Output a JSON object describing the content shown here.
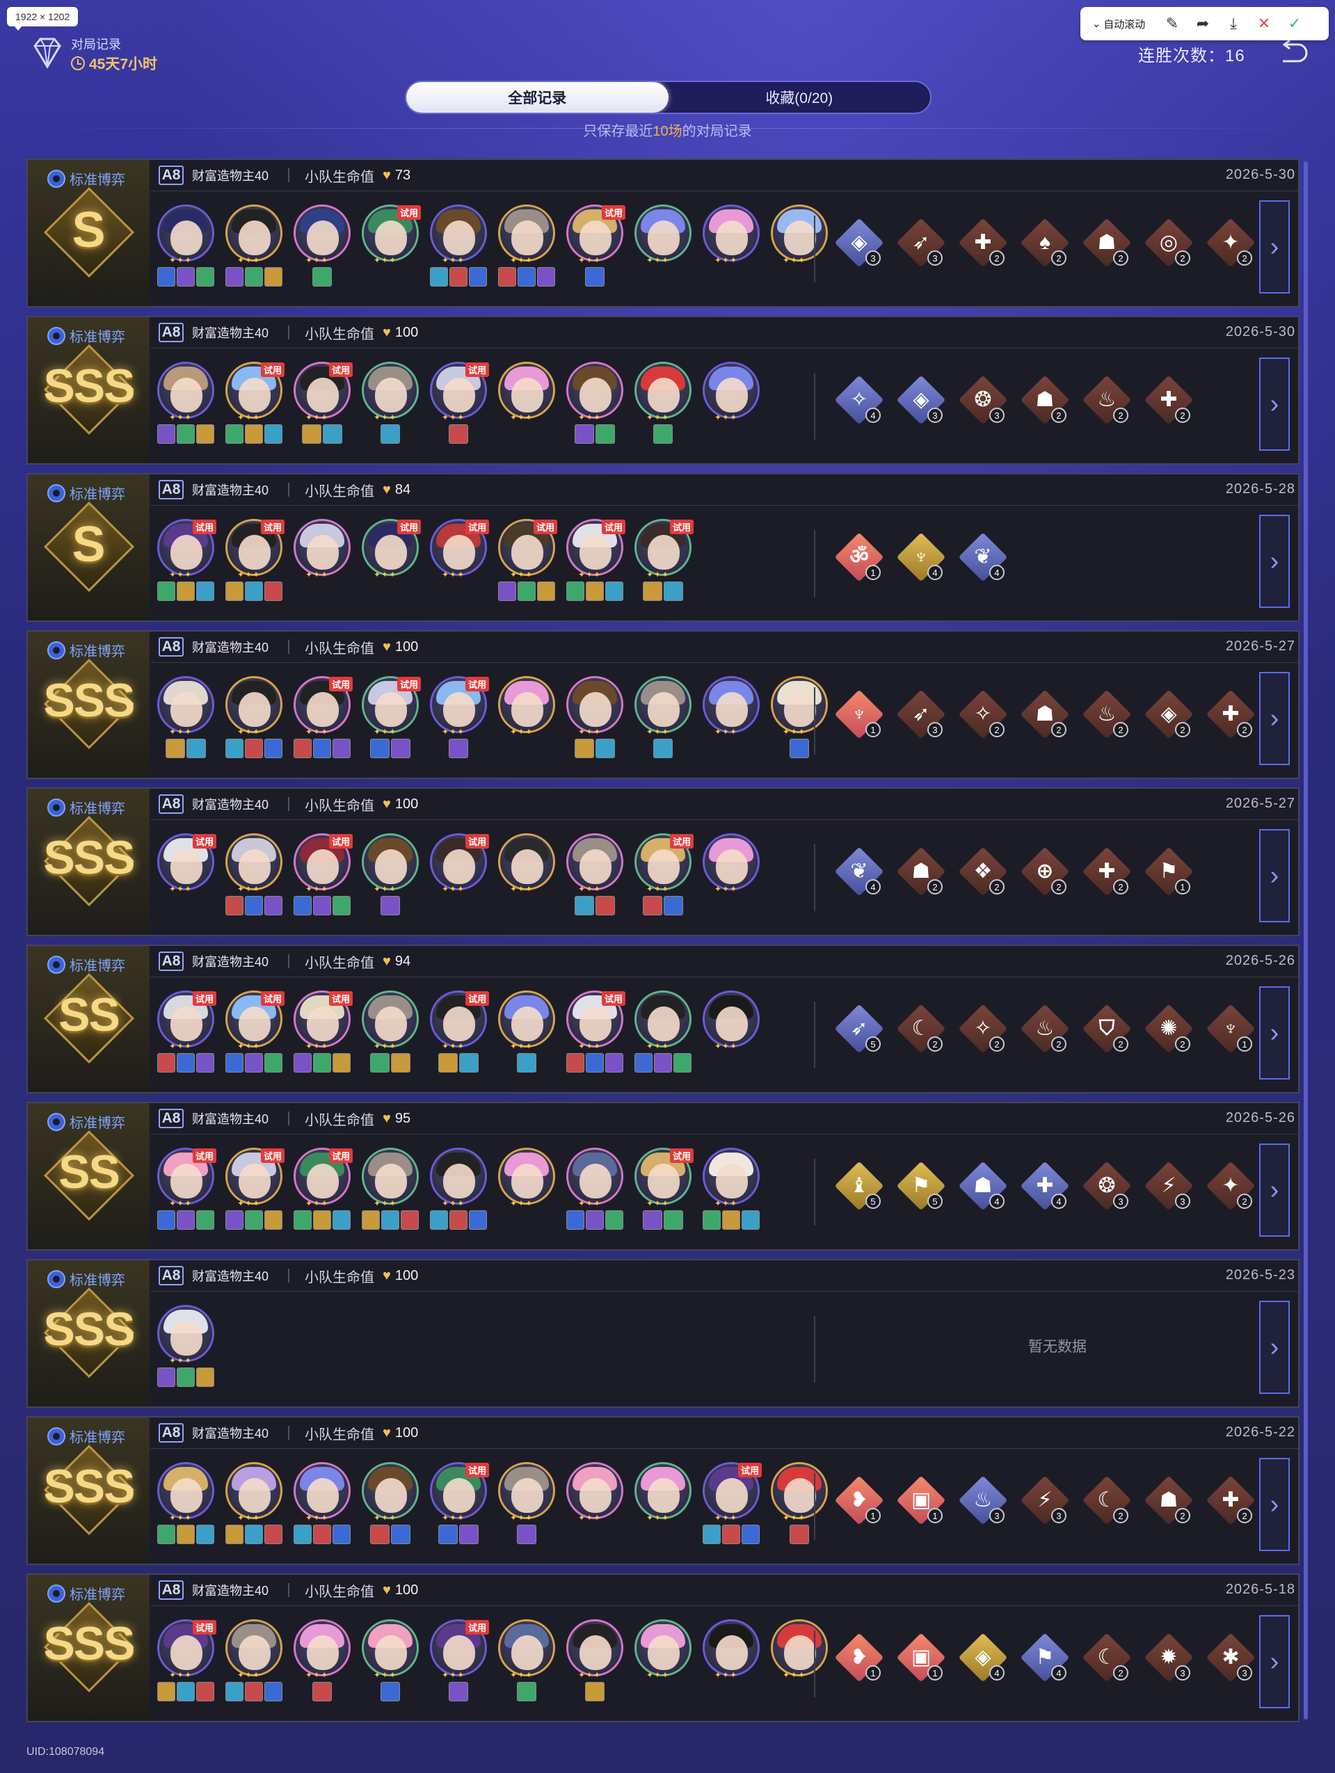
{
  "size_badge": "1922 × 1202",
  "header": {
    "title": "对局记录",
    "time": "45天7小时",
    "streak": "连胜次数：16"
  },
  "toolbar": {
    "auto_scroll": "自动滚动"
  },
  "tabs": [
    {
      "label": "全部记录"
    },
    {
      "label": "收藏(0/20)"
    }
  ],
  "hint": {
    "prefix": "只保存最近",
    "num": "10场",
    "suffix": "的对局记录"
  },
  "common": {
    "mode": "标准博弈",
    "level": "A8",
    "difficulty": "财富造物主40",
    "hp_label": "小队生命值",
    "nodata": "暂无数据"
  },
  "records": [
    {
      "grade": "S",
      "hp": "73",
      "date": "2026-5-30",
      "chars": [
        {
          "t": 0,
          "c": "#2a2a66",
          "r": 3
        },
        {
          "t": 0,
          "c": "#222",
          "r": 3
        },
        {
          "t": 0,
          "c": "#2f3f88",
          "r": 1
        },
        {
          "t": 1,
          "c": "#3b8a5e",
          "r": 0
        },
        {
          "t": 0,
          "c": "#6a4a2a",
          "r": 3
        },
        {
          "t": 0,
          "c": "#9a8f88",
          "r": 3
        },
        {
          "t": 1,
          "c": "#d4b06a",
          "r": 1
        },
        {
          "t": 0,
          "c": "#7a86e8",
          "r": 0
        },
        {
          "t": 0,
          "c": "#e89ad6",
          "r": 0
        },
        {
          "t": 0,
          "c": "#9ab8f0",
          "r": 0
        }
      ],
      "paths": [
        {
          "k": "b",
          "g": "◈",
          "n": "3"
        },
        {
          "k": "r",
          "g": "➶",
          "n": "3"
        },
        {
          "k": "r",
          "g": "✚",
          "n": "2"
        },
        {
          "k": "r",
          "g": "♠",
          "n": "2"
        },
        {
          "k": "r",
          "g": "☗",
          "n": "2"
        },
        {
          "k": "r",
          "g": "◎",
          "n": "2"
        },
        {
          "k": "r",
          "g": "✦",
          "n": "2"
        }
      ]
    },
    {
      "grade": "SSS",
      "hp": "100",
      "date": "2026-5-30",
      "chars": [
        {
          "t": 0,
          "c": "#b89a7a",
          "r": 3
        },
        {
          "t": 1,
          "c": "#8ab8f0",
          "r": 3
        },
        {
          "t": 1,
          "c": "#222",
          "r": 2
        },
        {
          "t": 0,
          "c": "#9a8f88",
          "r": 1
        },
        {
          "t": 1,
          "c": "#c8c8e0",
          "r": 1
        },
        {
          "t": 0,
          "c": "#e89ad6",
          "r": 0
        },
        {
          "t": 0,
          "c": "#6a4a2a",
          "r": 2
        },
        {
          "t": 0,
          "c": "#d83a3a",
          "r": 1
        },
        {
          "t": 0,
          "c": "#7a86e8",
          "r": 0
        }
      ],
      "paths": [
        {
          "k": "b",
          "g": "✧",
          "n": "4"
        },
        {
          "k": "b",
          "g": "◈",
          "n": "3"
        },
        {
          "k": "r",
          "g": "❂",
          "n": "3"
        },
        {
          "k": "r",
          "g": "☗",
          "n": "2"
        },
        {
          "k": "r",
          "g": "♨",
          "n": "2"
        },
        {
          "k": "r",
          "g": "✚",
          "n": "2"
        }
      ]
    },
    {
      "grade": "S",
      "hp": "84",
      "date": "2026-5-28",
      "chars": [
        {
          "t": 1,
          "c": "#5a3a8a",
          "r": 3
        },
        {
          "t": 1,
          "c": "#222",
          "r": 3
        },
        {
          "t": 0,
          "c": "#c8c8e0",
          "r": 0
        },
        {
          "t": 1,
          "c": "#2a2a66",
          "r": 0
        },
        {
          "t": 1,
          "c": "#b83a3a",
          "r": 0
        },
        {
          "t": 1,
          "c": "#4a3a2a",
          "r": 3
        },
        {
          "t": 1,
          "c": "#e0e0e8",
          "r": 3
        },
        {
          "t": 1,
          "c": "#3a2a2a",
          "r": 2
        }
      ],
      "paths": [
        {
          "k": "p",
          "g": "ॐ",
          "n": "1"
        },
        {
          "k": "y",
          "g": "♆",
          "n": "4"
        },
        {
          "k": "b",
          "g": "❦",
          "n": "4"
        }
      ]
    },
    {
      "grade": "SSS",
      "hp": "100",
      "date": "2026-5-27",
      "chars": [
        {
          "t": 0,
          "c": "#e0d8d0",
          "r": 2
        },
        {
          "t": 0,
          "c": "#222",
          "r": 3
        },
        {
          "t": 1,
          "c": "#222",
          "r": 3
        },
        {
          "t": 1,
          "c": "#c8c8e0",
          "r": 2
        },
        {
          "t": 1,
          "c": "#8ab8f0",
          "r": 1
        },
        {
          "t": 0,
          "c": "#e89ad6",
          "r": 0
        },
        {
          "t": 0,
          "c": "#6a4a2a",
          "r": 2
        },
        {
          "t": 0,
          "c": "#9a8f88",
          "r": 1
        },
        {
          "t": 0,
          "c": "#7a86e8",
          "r": 0
        },
        {
          "t": 0,
          "c": "#e8e0d0",
          "r": 1
        }
      ],
      "paths": [
        {
          "k": "p",
          "g": "♆",
          "n": "1"
        },
        {
          "k": "r",
          "g": "➶",
          "n": "3"
        },
        {
          "k": "r",
          "g": "✧",
          "n": "2"
        },
        {
          "k": "r",
          "g": "☗",
          "n": "2"
        },
        {
          "k": "r",
          "g": "♨",
          "n": "2"
        },
        {
          "k": "r",
          "g": "◈",
          "n": "2"
        },
        {
          "k": "r",
          "g": "✚",
          "n": "2"
        }
      ]
    },
    {
      "grade": "SSS",
      "hp": "100",
      "date": "2026-5-27",
      "chars": [
        {
          "t": 1,
          "c": "#e0e0e8",
          "r": 0
        },
        {
          "t": 0,
          "c": "#c8c8d8",
          "r": 3
        },
        {
          "t": 1,
          "c": "#8a2a3a",
          "r": 3
        },
        {
          "t": 0,
          "c": "#6a4a2a",
          "r": 1
        },
        {
          "t": 1,
          "c": "#3a2a2a",
          "r": 0
        },
        {
          "t": 0,
          "c": "#2a2a2a",
          "r": 0
        },
        {
          "t": 0,
          "c": "#9a8f88",
          "r": 2
        },
        {
          "t": 1,
          "c": "#d4b06a",
          "r": 2
        },
        {
          "t": 0,
          "c": "#e89ad6",
          "r": 0
        }
      ],
      "paths": [
        {
          "k": "b",
          "g": "❦",
          "n": "4"
        },
        {
          "k": "r",
          "g": "☗",
          "n": "2"
        },
        {
          "k": "r",
          "g": "❖",
          "n": "2"
        },
        {
          "k": "r",
          "g": "⊕",
          "n": "2"
        },
        {
          "k": "r",
          "g": "✚",
          "n": "2"
        },
        {
          "k": "r",
          "g": "⚑",
          "n": "1"
        }
      ]
    },
    {
      "grade": "SS",
      "hp": "94",
      "date": "2026-5-26",
      "chars": [
        {
          "t": 1,
          "c": "#d8d8e0",
          "r": 3
        },
        {
          "t": 1,
          "c": "#8ab8f0",
          "r": 3
        },
        {
          "t": 1,
          "c": "#e0d8c0",
          "r": 3
        },
        {
          "t": 0,
          "c": "#9a8f88",
          "r": 2
        },
        {
          "t": 1,
          "c": "#222",
          "r": 2
        },
        {
          "t": 0,
          "c": "#7a86e8",
          "r": 1
        },
        {
          "t": 1,
          "c": "#e0e0e8",
          "r": 3
        },
        {
          "t": 0,
          "c": "#222",
          "r": 3
        },
        {
          "t": 0,
          "c": "#1a1a1a",
          "r": 0
        }
      ],
      "paths": [
        {
          "k": "b",
          "g": "➶",
          "n": "5"
        },
        {
          "k": "r",
          "g": "☾",
          "n": "2"
        },
        {
          "k": "r",
          "g": "✧",
          "n": "2"
        },
        {
          "k": "r",
          "g": "♨",
          "n": "2"
        },
        {
          "k": "r",
          "g": "⛉",
          "n": "2"
        },
        {
          "k": "r",
          "g": "✺",
          "n": "2"
        },
        {
          "k": "r",
          "g": "♆",
          "n": "1"
        }
      ]
    },
    {
      "grade": "SS",
      "hp": "95",
      "date": "2026-5-26",
      "chars": [
        {
          "t": 1,
          "c": "#f0a0c0",
          "r": 3
        },
        {
          "t": 1,
          "c": "#c8c8e0",
          "r": 3
        },
        {
          "t": 1,
          "c": "#3b8a5e",
          "r": 3
        },
        {
          "t": 0,
          "c": "#9a8f88",
          "r": 3
        },
        {
          "t": 0,
          "c": "#222",
          "r": 3
        },
        {
          "t": 0,
          "c": "#e89ad6",
          "r": 0
        },
        {
          "t": 0,
          "c": "#5a6a9a",
          "r": 3
        },
        {
          "t": 1,
          "c": "#d4b06a",
          "r": 2
        },
        {
          "t": 0,
          "c": "#f0e8e0",
          "r": 3
        }
      ],
      "paths": [
        {
          "k": "y",
          "g": "♝",
          "n": "5"
        },
        {
          "k": "y",
          "g": "⚑",
          "n": "5"
        },
        {
          "k": "b",
          "g": "☗",
          "n": "4"
        },
        {
          "k": "b",
          "g": "✚",
          "n": "4"
        },
        {
          "k": "r",
          "g": "❂",
          "n": "3"
        },
        {
          "k": "r",
          "g": "⚡",
          "n": "3"
        },
        {
          "k": "r",
          "g": "✦",
          "n": "2"
        }
      ]
    },
    {
      "grade": "SSS",
      "hp": "100",
      "date": "2026-5-23",
      "chars": [
        {
          "t": 0,
          "c": "#e0e0e8",
          "r": 3
        }
      ],
      "paths": []
    },
    {
      "grade": "SSS",
      "hp": "100",
      "date": "2026-5-22",
      "chars": [
        {
          "t": 0,
          "c": "#d4b06a",
          "r": 3
        },
        {
          "t": 0,
          "c": "#b8a0e0",
          "r": 3
        },
        {
          "t": 0,
          "c": "#7a86e8",
          "r": 3
        },
        {
          "t": 0,
          "c": "#6a4a2a",
          "r": 2
        },
        {
          "t": 1,
          "c": "#3b8a5e",
          "r": 2
        },
        {
          "t": 0,
          "c": "#9a8f88",
          "r": 1
        },
        {
          "t": 0,
          "c": "#f0a0c0",
          "r": 0
        },
        {
          "t": 0,
          "c": "#e89ad6",
          "r": 0
        },
        {
          "t": 1,
          "c": "#5a3a8a",
          "r": 3
        },
        {
          "t": 0,
          "c": "#d83a3a",
          "r": 1
        }
      ],
      "paths": [
        {
          "k": "p",
          "g": "❥",
          "n": "1"
        },
        {
          "k": "p",
          "g": "▣",
          "n": "1"
        },
        {
          "k": "b",
          "g": "♨",
          "n": "3"
        },
        {
          "k": "r",
          "g": "⚡",
          "n": "3"
        },
        {
          "k": "r",
          "g": "☾",
          "n": "2"
        },
        {
          "k": "r",
          "g": "☗",
          "n": "2"
        },
        {
          "k": "r",
          "g": "✚",
          "n": "2"
        }
      ]
    },
    {
      "grade": "SSS",
      "hp": "100",
      "date": "2026-5-18",
      "chars": [
        {
          "t": 1,
          "c": "#5a3a8a",
          "r": 3
        },
        {
          "t": 0,
          "c": "#9a8f88",
          "r": 3
        },
        {
          "t": 0,
          "c": "#e89ad6",
          "r": 1
        },
        {
          "t": 0,
          "c": "#f0a0c0",
          "r": 1
        },
        {
          "t": 1,
          "c": "#5a3a8a",
          "r": 1
        },
        {
          "t": 0,
          "c": "#5a6a9a",
          "r": 1
        },
        {
          "t": 0,
          "c": "#222",
          "r": 1
        },
        {
          "t": 0,
          "c": "#e89ad6",
          "r": 0
        },
        {
          "t": 0,
          "c": "#1a1a1a",
          "r": 0
        },
        {
          "t": 0,
          "c": "#d83a3a",
          "r": 0
        }
      ],
      "paths": [
        {
          "k": "p",
          "g": "❥",
          "n": "1"
        },
        {
          "k": "p",
          "g": "▣",
          "n": "1"
        },
        {
          "k": "y",
          "g": "◈",
          "n": "4"
        },
        {
          "k": "b",
          "g": "⚑",
          "n": "4"
        },
        {
          "k": "r",
          "g": "☾",
          "n": "2"
        },
        {
          "k": "r",
          "g": "✹",
          "n": "3"
        },
        {
          "k": "r",
          "g": "✱",
          "n": "3"
        }
      ]
    }
  ],
  "trial_label": "试用",
  "uid": "UID:108078094",
  "colors": {
    "accent": "#5b6bf0",
    "gold": "#f5d987",
    "trial": "#e23b3b",
    "path_red": "#6b3a32",
    "path_blue": "#5b6ab8",
    "path_yellow": "#c9a13c",
    "path_pink": "#e2705a"
  }
}
